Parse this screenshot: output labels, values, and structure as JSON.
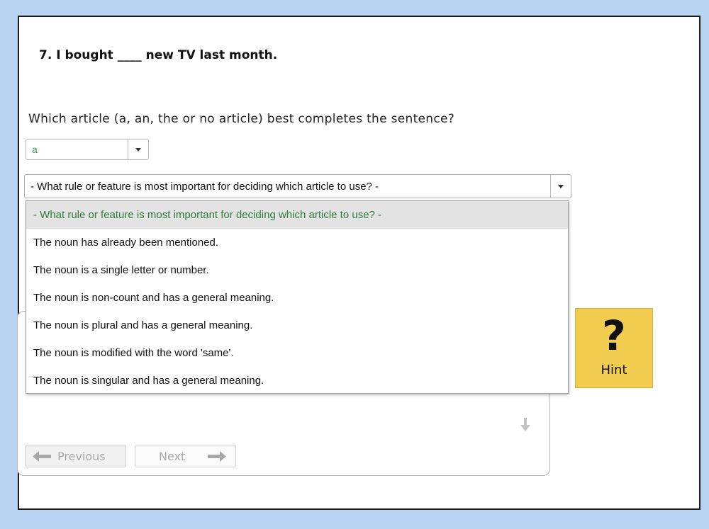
{
  "question": {
    "text": "7. I bought ____ new TV last month.",
    "instruction": "Which article (a, an, the or no article) best completes the sentence?"
  },
  "article_select": {
    "value": "a"
  },
  "rule_select": {
    "value": "- What rule or feature is most important for deciding which article to use? -",
    "options": [
      "- What rule or feature is most important for deciding which article to use? -",
      "The noun has already been mentioned.",
      "The noun is a single letter or number.",
      "The noun is non-count and has a general meaning.",
      "The noun is plural and has a general meaning.",
      "The noun is modified with the word 'same'.",
      "The noun is singular and has a general meaning."
    ]
  },
  "navigation": {
    "previous_label": "Previous",
    "next_label": "Next"
  },
  "hint": {
    "symbol": "?",
    "label": "Hint"
  },
  "colors": {
    "background": "#b9d3f3",
    "selected_value": "#3aa447",
    "hint_bg": "#f2cd4f"
  }
}
